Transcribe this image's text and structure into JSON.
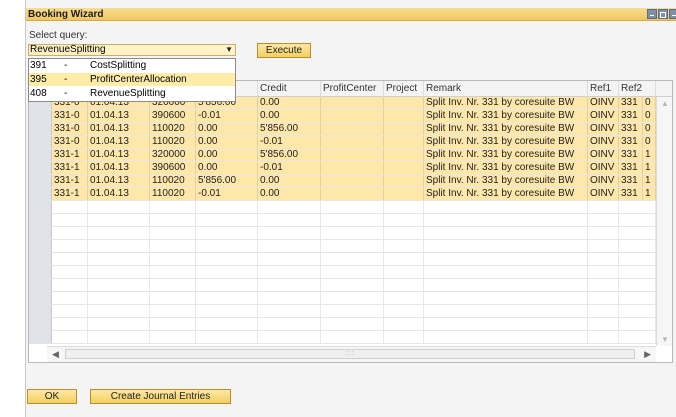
{
  "window": {
    "title": "Booking Wizard"
  },
  "query": {
    "label": "Select query:",
    "selected": "RevenueSplitting",
    "execute_label": "Execute",
    "options": [
      {
        "code": "391",
        "dash": "-",
        "name": "CostSplitting"
      },
      {
        "code": "395",
        "dash": "-",
        "name": "ProfitCenterAllocation"
      },
      {
        "code": "408",
        "dash": "-",
        "name": "RevenueSplitting"
      }
    ]
  },
  "table": {
    "columns": [
      "",
      "",
      "",
      "",
      "Credit",
      "ProfitCenter",
      "Project",
      "Remark",
      "Ref1",
      "Ref2"
    ],
    "rows": [
      [
        "331-0",
        "01.04.13",
        "320000",
        "5'856.00",
        "0.00",
        "",
        "",
        "Split Inv. Nr. 331 by coresuite BW",
        "OINV",
        "331",
        "0"
      ],
      [
        "331-0",
        "01.04.13",
        "390600",
        "-0.01",
        "0.00",
        "",
        "",
        "Split Inv. Nr. 331 by coresuite BW",
        "OINV",
        "331",
        "0"
      ],
      [
        "331-0",
        "01.04.13",
        "110020",
        "0.00",
        "5'856.00",
        "",
        "",
        "Split Inv. Nr. 331 by coresuite BW",
        "OINV",
        "331",
        "0"
      ],
      [
        "331-0",
        "01.04.13",
        "110020",
        "0.00",
        "-0.01",
        "",
        "",
        "Split Inv. Nr. 331 by coresuite BW",
        "OINV",
        "331",
        "0"
      ],
      [
        "331-1",
        "01.04.13",
        "320000",
        "0.00",
        "5'856.00",
        "",
        "",
        "Split Inv. Nr. 331 by coresuite BW",
        "OINV",
        "331",
        "1"
      ],
      [
        "331-1",
        "01.04.13",
        "390600",
        "0.00",
        "-0.01",
        "",
        "",
        "Split Inv. Nr. 331 by coresuite BW",
        "OINV",
        "331",
        "1"
      ],
      [
        "331-1",
        "01.04.13",
        "110020",
        "5'856.00",
        "0.00",
        "",
        "",
        "Split Inv. Nr. 331 by coresuite BW",
        "OINV",
        "331",
        "1"
      ],
      [
        "331-1",
        "01.04.13",
        "110020",
        "-0.01",
        "0.00",
        "",
        "",
        "Split Inv. Nr. 331 by coresuite BW",
        "OINV",
        "331",
        "1"
      ]
    ]
  },
  "footer": {
    "ok_label": "OK",
    "journal_label": "Create Journal Entries"
  },
  "icons": {
    "minimize": "minimize-icon",
    "maximize": "maximize-icon",
    "close": "close-icon"
  },
  "colors": {
    "row_highlight": "#ffe7aa",
    "title_bar": "#f0c862",
    "selected_option": "#ffeca9"
  }
}
